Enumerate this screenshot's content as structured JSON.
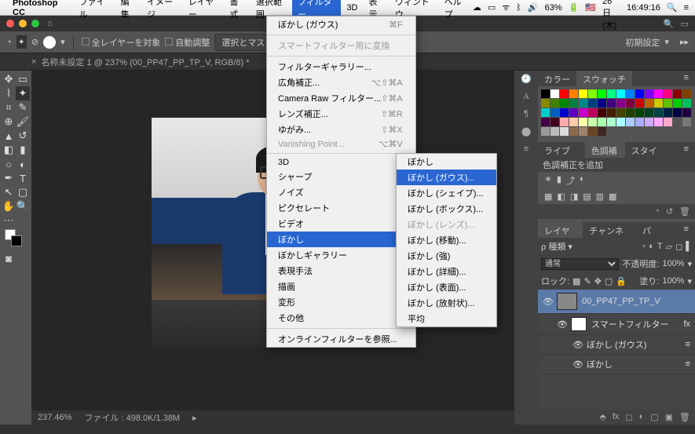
{
  "menubar": {
    "app_name": "Photoshop CC",
    "items": [
      "ファイル",
      "編集",
      "イメージ",
      "レイヤー",
      "書式",
      "選択範囲",
      "フィルター",
      "3D",
      "表示",
      "ウィンドウ",
      "ヘルプ"
    ],
    "status": {
      "battery": "63%",
      "flag": "🇺🇸",
      "date": "1月26日(木)",
      "time": "16:49:16"
    }
  },
  "optbar": {
    "all_layers": "全レイヤーを対象",
    "auto": "自動調整",
    "mask": "選択とマスク...",
    "preset": "初期設定"
  },
  "tab": {
    "close": "×",
    "title": "名称未設定 1 @ 237% (00_PP47_PP_TP_V, RGB/8) *"
  },
  "filter_menu": {
    "last": "ぼかし (ガウス)",
    "last_sc": "⌘F",
    "smart": "スマートフィルター用に変換",
    "gallery": "フィルターギャラリー...",
    "wide": "広角補正...",
    "wide_sc": "⌥⇧⌘A",
    "craw": "Camera Raw フィルター...",
    "craw_sc": "⇧⌘A",
    "lens": "レンズ補正...",
    "lens_sc": "⇧⌘R",
    "liquify": "ゆがみ...",
    "liquify_sc": "⇧⌘X",
    "vanish": "Vanishing Point...",
    "vanish_sc": "⌥⌘V",
    "g3d": "3D",
    "sharp": "シャープ",
    "noise": "ノイズ",
    "pix": "ピクセレート",
    "video": "ビデオ",
    "blur": "ぼかし",
    "blurg": "ぼかしギャラリー",
    "express": "表現手法",
    "draw": "描画",
    "distort": "変形",
    "other": "その他",
    "online": "オンラインフィルターを参照..."
  },
  "blur_sub": {
    "b": "ぼかし",
    "gauss": "ぼかし (ガウス)...",
    "shape": "ぼかし (シェイプ)...",
    "box": "ぼかし (ボックス)...",
    "lens": "ぼかし (レンズ)...",
    "motion": "ぼかし (移動)...",
    "strong": "ぼかし (強)",
    "detail": "ぼかし (詳細)...",
    "surface": "ぼかし (表面)...",
    "radial": "ぼかし (放射状)...",
    "avg": "平均"
  },
  "panels": {
    "color": "カラー",
    "swatch": "スウォッチ",
    "lib": "ライブラリ",
    "cc": "色調補正",
    "style": "スタイル",
    "cc_add": "色調補正を追加",
    "layer": "レイヤー",
    "channel": "チャンネル",
    "path": "パス",
    "kind": "種類",
    "normal": "通常",
    "opacity_l": "不透明度:",
    "opacity_v": "100%",
    "lock": "ロック:",
    "fill_l": "塗り:",
    "fill_v": "100%",
    "l1": "00_PP47_PP_TP_V",
    "sf": "スマートフィルター",
    "f1": "ぼかし (ガウス)",
    "f2": "ぼかし"
  },
  "status": {
    "zoom": "237.46%",
    "file": "ファイル : 498.0K/1.38M"
  },
  "swatch_colors": [
    "#000",
    "#fff",
    "#f00",
    "#ff8000",
    "#ff0",
    "#80ff00",
    "#0f0",
    "#00ff80",
    "#0ff",
    "#0080ff",
    "#00f",
    "#8000ff",
    "#f0f",
    "#ff0080",
    "#800",
    "#804000",
    "#880",
    "#408000",
    "#080",
    "#008040",
    "#088",
    "#004080",
    "#008",
    "#400080",
    "#808",
    "#800040",
    "#c00",
    "#c06000",
    "#cc0",
    "#60c000",
    "#0c0",
    "#00c060",
    "#0cc",
    "#0060c0",
    "#00c",
    "#6000c0",
    "#c0c",
    "#c00060",
    "#400",
    "#402000",
    "#440",
    "#204000",
    "#040",
    "#004020",
    "#044",
    "#002040",
    "#004",
    "#200040",
    "#404",
    "#400020",
    "#faa",
    "#fca",
    "#ffa",
    "#cfa",
    "#afa",
    "#afc",
    "#aff",
    "#acf",
    "#aaf",
    "#caf",
    "#faf",
    "#fac",
    "#555",
    "#777",
    "#999",
    "#bbb",
    "#ddd",
    "#8a6a4a",
    "#a0826d",
    "#6b4423",
    "#3e2723"
  ]
}
